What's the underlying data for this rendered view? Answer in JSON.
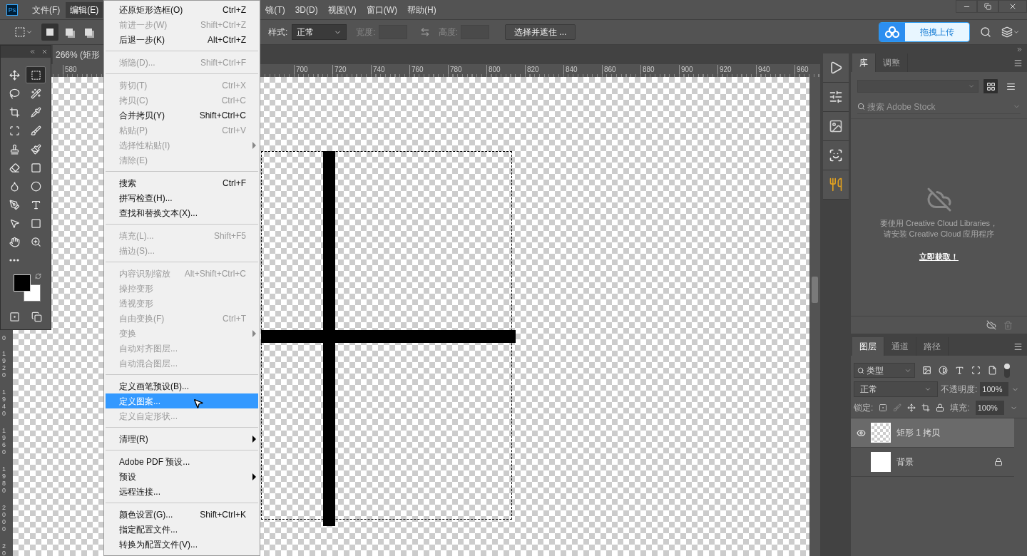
{
  "menu_bar": {
    "app_icon": "Ps",
    "items": [
      {
        "label": "文件(F)",
        "selected": false
      },
      {
        "label": "编辑(E)",
        "selected": true
      },
      {
        "label": "镜(T)",
        "selected": false
      },
      {
        "label": "3D(D)",
        "selected": false
      },
      {
        "label": "视图(V)",
        "selected": false
      },
      {
        "label": "窗口(W)",
        "selected": false
      },
      {
        "label": "帮助(H)",
        "selected": false
      }
    ]
  },
  "options_bar": {
    "mode_buttons": [
      {
        "selected": true
      },
      {
        "selected": false
      },
      {
        "selected": false
      }
    ],
    "style_label": "样式:",
    "style_value": "正常",
    "width_label": "宽度:",
    "height_label": "高度:",
    "select_mask_button": "选择并遮住 ...",
    "upload_button": "拖拽上传"
  },
  "document_tab": "266% (矩形",
  "ruler": {
    "x_first": "580",
    "x_labels": [
      "700",
      "720",
      "740",
      "760",
      "780",
      "800",
      "820",
      "840",
      "860",
      "880",
      "900",
      "920",
      "940",
      "960"
    ],
    "y_labels": [
      "0",
      "1920",
      "1940",
      "1960",
      "1980",
      "2000",
      "20"
    ]
  },
  "toolbox": {
    "tools": [
      {
        "kind": "move",
        "selected": false
      },
      {
        "kind": "marquee",
        "selected": true
      },
      {
        "kind": "lasso",
        "selected": false
      },
      {
        "kind": "wand",
        "selected": false
      },
      {
        "kind": "crop",
        "selected": false
      },
      {
        "kind": "eyedropper",
        "selected": false
      },
      {
        "kind": "frame",
        "selected": false
      },
      {
        "kind": "brush",
        "selected": false
      },
      {
        "kind": "stamp",
        "selected": false
      },
      {
        "kind": "history",
        "selected": false
      },
      {
        "kind": "eraser",
        "selected": false
      },
      {
        "kind": "gradient",
        "selected": false
      },
      {
        "kind": "blur",
        "selected": false
      },
      {
        "kind": "dodge",
        "selected": false
      },
      {
        "kind": "pen",
        "selected": false
      },
      {
        "kind": "type",
        "selected": false
      },
      {
        "kind": "pointer",
        "selected": false
      },
      {
        "kind": "rectangle",
        "selected": false
      },
      {
        "kind": "hand",
        "selected": false
      },
      {
        "kind": "zoom",
        "selected": false
      },
      {
        "kind": "more",
        "selected": false
      }
    ]
  },
  "edit_menu": {
    "items": [
      {
        "kind": "item",
        "label": "还原矩形选框(O)",
        "shortcut": "Ctrl+Z",
        "disabled": false,
        "submenu": false,
        "selected": false
      },
      {
        "kind": "item",
        "label": "前进一步(W)",
        "shortcut": "Shift+Ctrl+Z",
        "disabled": true,
        "submenu": false,
        "selected": false
      },
      {
        "kind": "item",
        "label": "后退一步(K)",
        "shortcut": "Alt+Ctrl+Z",
        "disabled": false,
        "submenu": false,
        "selected": false
      },
      {
        "kind": "separator"
      },
      {
        "kind": "item",
        "label": "渐隐(D)...",
        "shortcut": "Shift+Ctrl+F",
        "disabled": true,
        "submenu": false,
        "selected": false
      },
      {
        "kind": "separator"
      },
      {
        "kind": "item",
        "label": "剪切(T)",
        "shortcut": "Ctrl+X",
        "disabled": true,
        "submenu": false,
        "selected": false
      },
      {
        "kind": "item",
        "label": "拷贝(C)",
        "shortcut": "Ctrl+C",
        "disabled": true,
        "submenu": false,
        "selected": false
      },
      {
        "kind": "item",
        "label": "合并拷贝(Y)",
        "shortcut": "Shift+Ctrl+C",
        "disabled": false,
        "submenu": false,
        "selected": false
      },
      {
        "kind": "item",
        "label": "粘贴(P)",
        "shortcut": "Ctrl+V",
        "disabled": true,
        "submenu": false,
        "selected": false
      },
      {
        "kind": "item",
        "label": "选择性粘贴(I)",
        "disabled": true,
        "submenu": true,
        "selected": false
      },
      {
        "kind": "item",
        "label": "清除(E)",
        "disabled": true,
        "submenu": false,
        "selected": false
      },
      {
        "kind": "separator"
      },
      {
        "kind": "item",
        "label": "搜索",
        "shortcut": "Ctrl+F",
        "disabled": false,
        "submenu": false,
        "selected": false
      },
      {
        "kind": "item",
        "label": "拼写检查(H)...",
        "disabled": false,
        "submenu": false,
        "selected": false
      },
      {
        "kind": "item",
        "label": "查找和替换文本(X)...",
        "disabled": false,
        "submenu": false,
        "selected": false
      },
      {
        "kind": "separator"
      },
      {
        "kind": "item",
        "label": "填充(L)...",
        "shortcut": "Shift+F5",
        "disabled": true,
        "submenu": false,
        "selected": false
      },
      {
        "kind": "item",
        "label": "描边(S)...",
        "disabled": true,
        "submenu": false,
        "selected": false
      },
      {
        "kind": "separator"
      },
      {
        "kind": "item",
        "label": "内容识别缩放",
        "shortcut": "Alt+Shift+Ctrl+C",
        "disabled": true,
        "submenu": false,
        "selected": false
      },
      {
        "kind": "item",
        "label": "操控变形",
        "disabled": true,
        "submenu": false,
        "selected": false
      },
      {
        "kind": "item",
        "label": "透视变形",
        "disabled": true,
        "submenu": false,
        "selected": false
      },
      {
        "kind": "item",
        "label": "自由变换(F)",
        "shortcut": "Ctrl+T",
        "disabled": true,
        "submenu": false,
        "selected": false
      },
      {
        "kind": "item",
        "label": "变换",
        "disabled": true,
        "submenu": true,
        "selected": false
      },
      {
        "kind": "item",
        "label": "自动对齐图层...",
        "disabled": true,
        "submenu": false,
        "selected": false
      },
      {
        "kind": "item",
        "label": "自动混合图层...",
        "disabled": true,
        "submenu": false,
        "selected": false
      },
      {
        "kind": "separator"
      },
      {
        "kind": "item",
        "label": "定义画笔预设(B)...",
        "disabled": false,
        "submenu": false,
        "selected": false
      },
      {
        "kind": "item",
        "label": "定义图案...",
        "disabled": false,
        "submenu": false,
        "selected": true
      },
      {
        "kind": "item",
        "label": "定义自定形状...",
        "disabled": true,
        "submenu": false,
        "selected": false
      },
      {
        "kind": "separator"
      },
      {
        "kind": "item",
        "label": "清理(R)",
        "disabled": false,
        "submenu": true,
        "selected": false
      },
      {
        "kind": "separator"
      },
      {
        "kind": "item",
        "label": "Adobe PDF 预设...",
        "disabled": false,
        "submenu": false,
        "selected": false
      },
      {
        "kind": "item",
        "label": "预设",
        "disabled": false,
        "submenu": true,
        "selected": false
      },
      {
        "kind": "item",
        "label": "远程连接...",
        "disabled": false,
        "submenu": false,
        "selected": false
      },
      {
        "kind": "separator"
      },
      {
        "kind": "item",
        "label": "颜色设置(G)...",
        "shortcut": "Shift+Ctrl+K",
        "disabled": false,
        "submenu": false,
        "selected": false
      },
      {
        "kind": "item",
        "label": "指定配置文件...",
        "disabled": false,
        "submenu": false,
        "selected": false
      },
      {
        "kind": "item",
        "label": "转换为配置文件(V)...",
        "disabled": false,
        "submenu": false,
        "selected": false
      }
    ]
  },
  "library_panel": {
    "tabs": [
      {
        "label": "库",
        "selected": true
      },
      {
        "label": "调整",
        "selected": false
      }
    ],
    "view_buttons": [
      {
        "kind": "grid",
        "selected": true
      },
      {
        "kind": "list",
        "selected": false
      }
    ],
    "search_placeholder": "搜索 Adobe Stock",
    "message_lines": [
      "要使用 Creative Cloud Libraries，",
      "请安装 Creative Cloud 应用程序"
    ],
    "link": "立即获取！"
  },
  "layers_panel": {
    "tabs": [
      {
        "label": "图层",
        "selected": true
      },
      {
        "label": "通道",
        "selected": false
      },
      {
        "label": "路径",
        "selected": false
      }
    ],
    "filter": "类型",
    "blend_mode": "正常",
    "opacity_label": "不透明度:",
    "opacity": "100%",
    "lock_label": "锁定:",
    "fill_label": "填充:",
    "fill": "100%",
    "layers": [
      {
        "name": "矩形 1 拷贝",
        "kind": "shape",
        "selected": true,
        "visible": true,
        "locked": false
      },
      {
        "name": "背景",
        "kind": "background",
        "selected": false,
        "visible": false,
        "locked": true
      }
    ]
  }
}
